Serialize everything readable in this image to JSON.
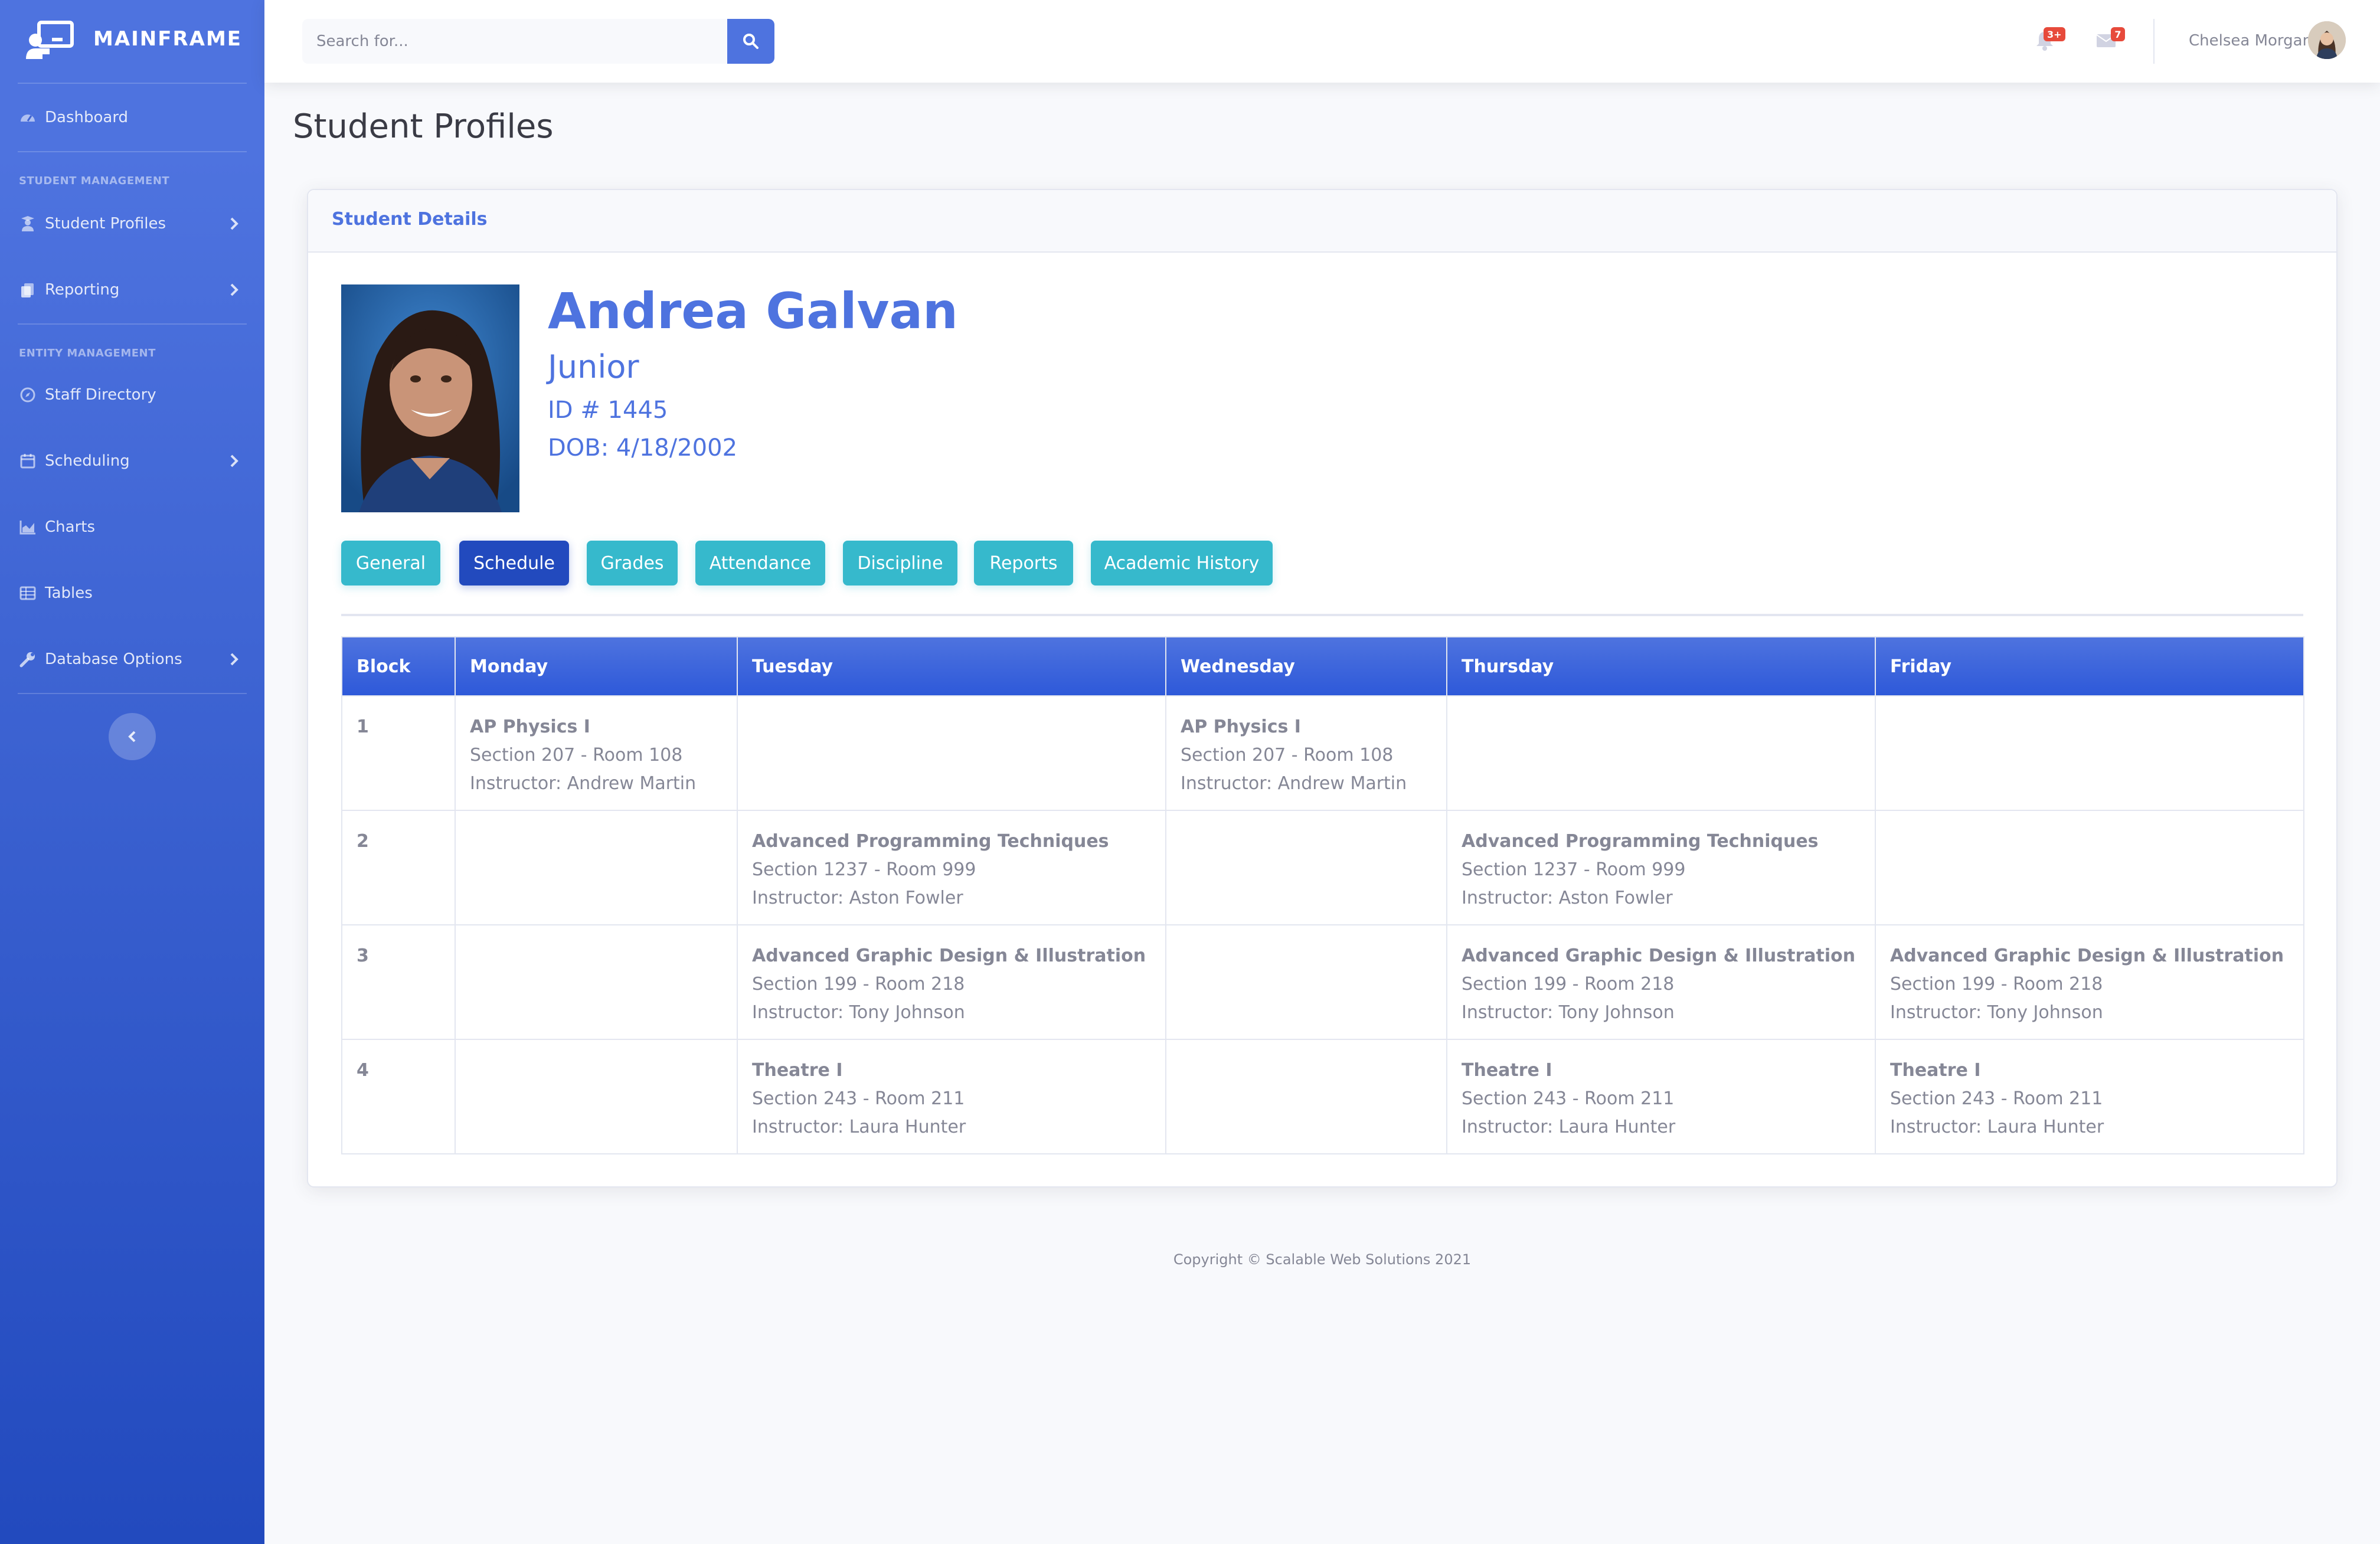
{
  "app": {
    "brand": "MAINFRAME"
  },
  "sidebar": {
    "dashboard": "Dashboard",
    "heading_student": "STUDENT MANAGEMENT",
    "student_profiles": "Student Profiles",
    "reporting": "Reporting",
    "heading_entity": "ENTITY MANAGEMENT",
    "staff_directory": "Staff Directory",
    "scheduling": "Scheduling",
    "charts": "Charts",
    "tables": "Tables",
    "database_options": "Database Options"
  },
  "topbar": {
    "search_placeholder": "Search for...",
    "alerts_badge": "3+",
    "messages_badge": "7",
    "user_name": "Chelsea Morgan"
  },
  "page": {
    "title": "Student Profiles"
  },
  "card": {
    "header": "Student Details"
  },
  "student": {
    "name": "Andrea Galvan",
    "grade": "Junior",
    "id": "ID # 1445",
    "dob": "DOB: 4/18/2002"
  },
  "tabs": [
    {
      "label": "General",
      "active": false
    },
    {
      "label": "Schedule",
      "active": true
    },
    {
      "label": "Grades",
      "active": false
    },
    {
      "label": "Attendance",
      "active": false
    },
    {
      "label": "Discipline",
      "active": false
    },
    {
      "label": "Reports",
      "active": false
    },
    {
      "label": "Academic History",
      "active": false
    }
  ],
  "schedule": {
    "headers": [
      "Block",
      "Monday",
      "Tuesday",
      "Wednesday",
      "Thursday",
      "Friday"
    ],
    "rows": [
      {
        "block": "1",
        "days": [
          {
            "name": "AP Physics I",
            "section": "Section 207 - Room 108",
            "instructor": "Instructor: Andrew Martin"
          },
          {
            "name": "",
            "section": "",
            "instructor": ""
          },
          {
            "name": "AP Physics I",
            "section": "Section 207 - Room 108",
            "instructor": "Instructor: Andrew Martin"
          },
          {
            "name": "",
            "section": "",
            "instructor": ""
          },
          {
            "name": "",
            "section": "",
            "instructor": ""
          }
        ]
      },
      {
        "block": "2",
        "days": [
          {
            "name": "",
            "section": "",
            "instructor": ""
          },
          {
            "name": "Advanced Programming Techniques",
            "section": "Section 1237 - Room 999",
            "instructor": "Instructor: Aston Fowler"
          },
          {
            "name": "",
            "section": "",
            "instructor": ""
          },
          {
            "name": "Advanced Programming Techniques",
            "section": "Section 1237 - Room 999",
            "instructor": "Instructor: Aston Fowler"
          },
          {
            "name": "",
            "section": "",
            "instructor": ""
          }
        ]
      },
      {
        "block": "3",
        "days": [
          {
            "name": "",
            "section": "",
            "instructor": ""
          },
          {
            "name": "Advanced Graphic Design & Illustration",
            "section": "Section 199 - Room 218",
            "instructor": "Instructor: Tony Johnson"
          },
          {
            "name": "",
            "section": "",
            "instructor": ""
          },
          {
            "name": "Advanced Graphic Design & Illustration",
            "section": "Section 199 - Room 218",
            "instructor": "Instructor: Tony Johnson"
          },
          {
            "name": "Advanced Graphic Design & Illustration",
            "section": "Section 199 - Room 218",
            "instructor": "Instructor: Tony Johnson"
          }
        ]
      },
      {
        "block": "4",
        "days": [
          {
            "name": "",
            "section": "",
            "instructor": ""
          },
          {
            "name": "Theatre I",
            "section": "Section 243 - Room 211",
            "instructor": "Instructor: Laura Hunter"
          },
          {
            "name": "",
            "section": "",
            "instructor": ""
          },
          {
            "name": "Theatre I",
            "section": "Section 243 - Room 211",
            "instructor": "Instructor: Laura Hunter"
          },
          {
            "name": "Theatre I",
            "section": "Section 243 - Room 211",
            "instructor": "Instructor: Laura Hunter"
          }
        ]
      }
    ]
  },
  "footer": {
    "copyright": "Copyright © Scalable Web Solutions 2021"
  },
  "colors": {
    "primary": "#4e73df",
    "primary_dark": "#224abe",
    "info": "#36b9cc",
    "danger": "#e74a3b",
    "text_muted": "#858796"
  }
}
